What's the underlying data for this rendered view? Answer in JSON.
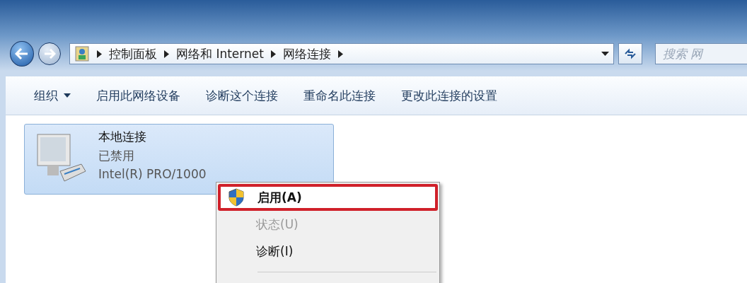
{
  "address_bar": {
    "crumbs": [
      "控制面板",
      "网络和 Internet",
      "网络连接"
    ]
  },
  "search": {
    "placeholder": "搜索 网"
  },
  "toolbar": [
    {
      "label": "组织",
      "dropdown": true
    },
    {
      "label": "启用此网络设备",
      "dropdown": false
    },
    {
      "label": "诊断这个连接",
      "dropdown": false
    },
    {
      "label": "重命名此连接",
      "dropdown": false
    },
    {
      "label": "更改此连接的设置",
      "dropdown": false
    }
  ],
  "connections": [
    {
      "name": "本地连接",
      "status": "已禁用",
      "adapter": "Intel(R) PRO/1000",
      "selected": true
    }
  ],
  "context_menu": [
    {
      "label": "启用(A)",
      "bold": true,
      "disabled": false,
      "highlighted": true,
      "shield": true
    },
    {
      "label": "状态(U)",
      "bold": false,
      "disabled": true,
      "highlighted": false,
      "shield": false
    },
    {
      "label": "诊断(I)",
      "bold": false,
      "disabled": false,
      "highlighted": false,
      "shield": false
    }
  ]
}
